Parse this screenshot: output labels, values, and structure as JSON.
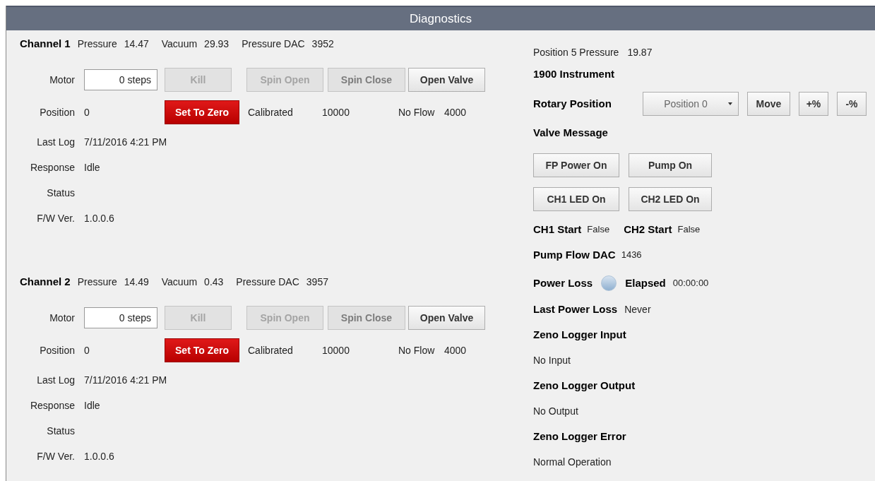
{
  "window": {
    "title": "Diagnostics"
  },
  "channels": [
    {
      "title": "Channel 1",
      "stats": [
        {
          "label": "Pressure",
          "value": "14.47"
        },
        {
          "label": "Vacuum",
          "value": "29.93"
        },
        {
          "label": "Pressure DAC",
          "value": "3952"
        }
      ],
      "motor": {
        "label": "Motor",
        "value": "0 steps"
      },
      "buttons": [
        {
          "label": "Kill",
          "kind": "disabled"
        },
        {
          "label": "Spin Open",
          "kind": "disabled"
        },
        {
          "label": "Spin Close",
          "kind": "muted"
        },
        {
          "label": "Open Valve",
          "kind": "normal"
        }
      ],
      "position": {
        "label": "Position",
        "value": "0"
      },
      "zero_button": {
        "label": "Set To Zero"
      },
      "calibrated": {
        "label": "Calibrated",
        "value": "10000"
      },
      "no_flow": {
        "label": "No Flow",
        "value": "4000"
      },
      "info": [
        {
          "label": "Last Log",
          "value": "7/11/2016 4:21 PM"
        },
        {
          "label": "Response",
          "value": "Idle"
        },
        {
          "label": "Status"
        },
        {
          "label": "F/W Ver.",
          "value": "1.0.0.6"
        }
      ]
    },
    {
      "title": "Channel 2",
      "stats": [
        {
          "label": "Pressure",
          "value": "14.49"
        },
        {
          "label": "Vacuum",
          "value": "0.43"
        },
        {
          "label": "Pressure DAC",
          "value": "3957"
        }
      ],
      "motor": {
        "label": "Motor",
        "value": "0 steps"
      },
      "buttons": [
        {
          "label": "Kill",
          "kind": "disabled"
        },
        {
          "label": "Spin Open",
          "kind": "disabled"
        },
        {
          "label": "Spin Close",
          "kind": "muted"
        },
        {
          "label": "Open Valve",
          "kind": "normal"
        }
      ],
      "position": {
        "label": "Position",
        "value": "0"
      },
      "zero_button": {
        "label": "Set To Zero"
      },
      "calibrated": {
        "label": "Calibrated",
        "value": "10000"
      },
      "no_flow": {
        "label": "No Flow",
        "value": "4000"
      },
      "info": [
        {
          "label": "Last Log",
          "value": "7/11/2016 4:21 PM"
        },
        {
          "label": "Response",
          "value": "Idle"
        },
        {
          "label": "Status"
        },
        {
          "label": "F/W Ver.",
          "value": "1.0.0.6"
        }
      ]
    }
  ],
  "instrument": {
    "position_pressure": {
      "label": "Position 5 Pressure",
      "value": "19.87"
    },
    "title": "1900 Instrument",
    "rotary": {
      "label": "Rotary Position",
      "dropdown": "Position 0",
      "buttons": [
        "Move",
        "+%",
        "-%"
      ]
    },
    "valve_message": "Valve Message",
    "valve_buttons": [
      [
        "FP Power On",
        "Pump On"
      ],
      [
        "CH1 LED On",
        "CH2 LED On"
      ]
    ],
    "starts": [
      {
        "label": "CH1 Start",
        "value": "False"
      },
      {
        "label": "CH2 Start",
        "value": "False"
      }
    ],
    "pump_flow": {
      "label": "Pump Flow DAC",
      "value": "1436"
    },
    "power_loss": {
      "label": "Power Loss",
      "on": false,
      "elapsed_label": "Elapsed",
      "elapsed_value": "00:00:00"
    },
    "last_power_loss": {
      "label": "Last Power Loss",
      "value": "Never"
    },
    "zeno": [
      {
        "title": "Zeno Logger Input",
        "value": "No Input"
      },
      {
        "title": "Zeno Logger Output",
        "value": "No Output"
      },
      {
        "title": "Zeno Logger Error",
        "value": "Normal Operation"
      }
    ]
  }
}
